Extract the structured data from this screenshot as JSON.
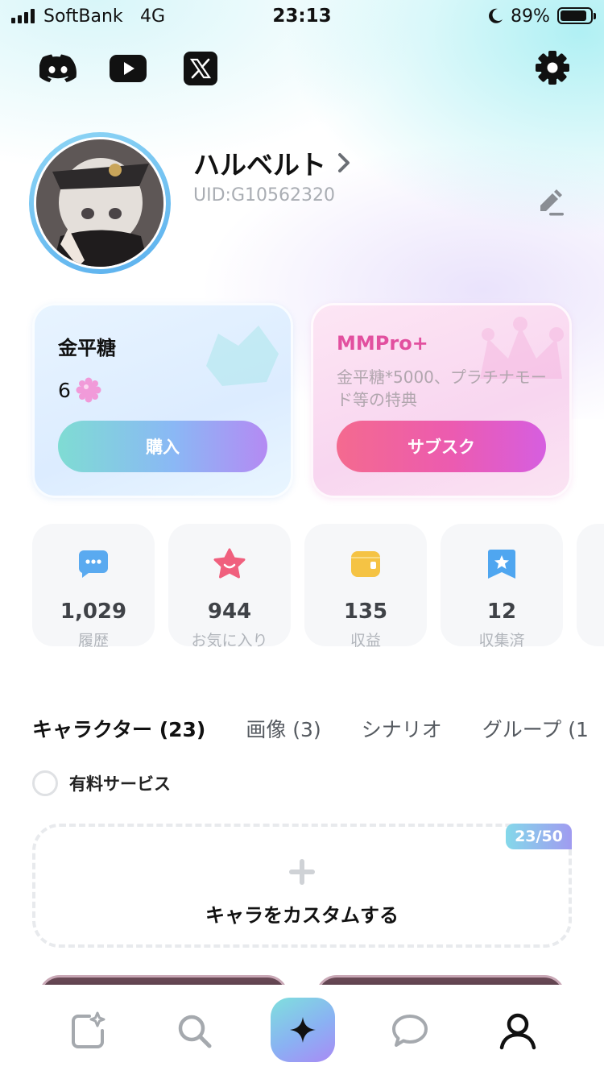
{
  "status_bar": {
    "carrier": "SoftBank",
    "network": "4G",
    "time": "23:13",
    "battery_percent": "89%",
    "battery_level": 0.89
  },
  "header": {
    "social_icons": [
      "discord-icon",
      "youtube-icon",
      "x-icon"
    ],
    "settings_icon": "gear-icon"
  },
  "profile": {
    "name": "ハルベルト",
    "uid": "UID:G10562320"
  },
  "cards": {
    "currency": {
      "title": "金平糖",
      "value": "6",
      "button": "購入"
    },
    "subscription": {
      "title": "MMPro+",
      "description": "金平糖*5000、プラチナモード等の特典",
      "button": "サブスク"
    }
  },
  "stats": [
    {
      "icon": "chat-bubble-icon",
      "value": "1,029",
      "label": "履歴",
      "color": "#5aaaf0"
    },
    {
      "icon": "smiling-star-icon",
      "value": "944",
      "label": "お気に入り",
      "color": "#f0607e"
    },
    {
      "icon": "wallet-icon",
      "value": "135",
      "label": "収益",
      "color": "#f5c344"
    },
    {
      "icon": "bookmark-star-icon",
      "value": "12",
      "label": "収集済",
      "color": "#4fa6f0"
    },
    {
      "icon": "",
      "value": "",
      "label": "フ",
      "color": "#c7cbd0"
    }
  ],
  "tabs": [
    {
      "label": "キャラクター (23)",
      "active": true
    },
    {
      "label": "画像 (3)",
      "active": false
    },
    {
      "label": "シナリオ",
      "active": false
    },
    {
      "label": "グループ (1",
      "active": false
    }
  ],
  "filter": {
    "paid_service_label": "有料サービス",
    "checked": false
  },
  "create": {
    "label": "キャラをカスタムする",
    "count": "23/50"
  },
  "bottom_nav": [
    {
      "icon": "create-sparkle-icon"
    },
    {
      "icon": "search-icon"
    },
    {
      "icon": "sparkle-icon"
    },
    {
      "icon": "chat-icon"
    },
    {
      "icon": "profile-icon"
    }
  ],
  "colors": {
    "accent_pink": "#e2509f",
    "uid_gray": "#a9adb3"
  }
}
